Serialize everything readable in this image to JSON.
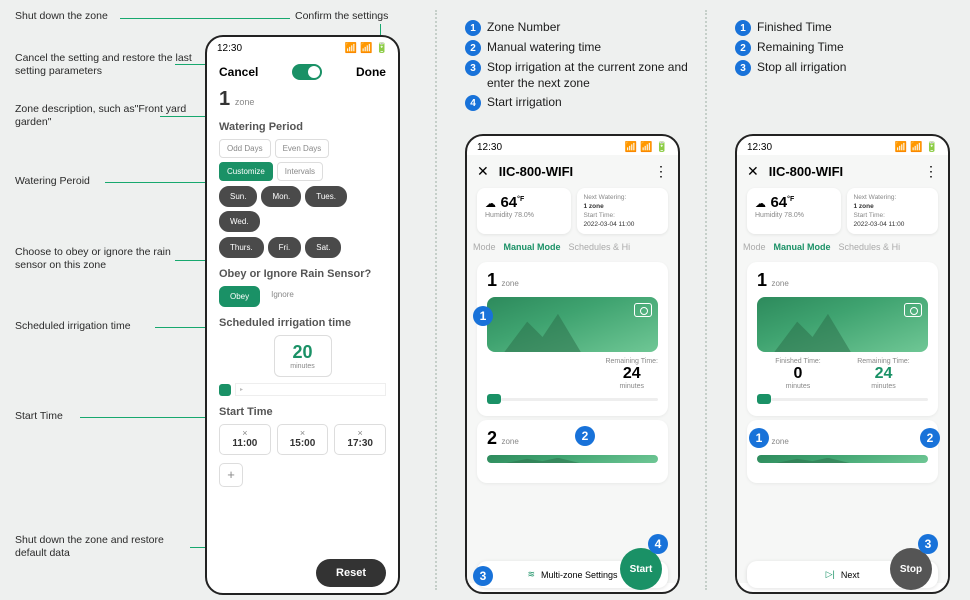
{
  "annotations": {
    "shutdown": "Shut down the zone",
    "confirm": "Confirm the settings",
    "cancel": "Cancel the setting and restore the last setting parameters",
    "zone_desc": "Zone description, such as\"Front yard garden\"",
    "watering_period": "Watering Peroid",
    "rain_sensor": "Choose to obey or ignore the rain sensor on this zone",
    "scheduled": "Scheduled irrigation time",
    "start_time": "Start Time",
    "reset": "Shut down the zone and restore default data"
  },
  "phone1": {
    "time": "12:30",
    "cancel": "Cancel",
    "done": "Done",
    "zone_num": "1",
    "zone_label": "zone",
    "watering_period_title": "Watering Period",
    "periods": [
      "Odd Days",
      "Even Days",
      "Customize",
      "Intervals"
    ],
    "days": [
      "Sun.",
      "Mon.",
      "Tues.",
      "Wed.",
      "Thurs.",
      "Fri.",
      "Sat."
    ],
    "rain_title": "Obey or Ignore Rain Sensor?",
    "obey": "Obey",
    "ignore": "Ignore",
    "sched_title": "Scheduled irrigation time",
    "sched_val": "20",
    "sched_unit": "minutes",
    "start_title": "Start Time",
    "times": [
      "11:00",
      "15:00",
      "17:30"
    ],
    "reset": "Reset"
  },
  "phone2": {
    "time": "12:30",
    "device": "IIC-800-WIFI",
    "temp": "64",
    "temp_unit": "°F",
    "humidity": "Humidity  78.0%",
    "next_label": "Next Watering:",
    "next_zone": "1 zone",
    "start_label": "Start Time:",
    "start_val": "2022-03-04 11:00",
    "tabs": [
      "Mode",
      "Manual Mode",
      "Schedules & Hi"
    ],
    "zone1_num": "1",
    "zone1_label": "zone",
    "remaining_label": "Remaining Time:",
    "remaining_val": "24",
    "remaining_unit": "minutes",
    "zone2_num": "2",
    "zone2_label": "zone",
    "multizone": "Multi-zone Settings",
    "start_btn": "Start"
  },
  "phone3": {
    "time": "12:30",
    "device": "IIC-800-WIFI",
    "temp": "64",
    "humidity": "Humidity  78.0%",
    "next_label": "Next Watering:",
    "next_zone": "1 zone",
    "start_label": "Start Time:",
    "start_val": "2022-03-04 11:00",
    "tabs": [
      "Mode",
      "Manual Mode",
      "Schedules & Hi"
    ],
    "zone1_num": "1",
    "finished_label": "Finished Time:",
    "finished_val": "0",
    "finished_unit": "minutes",
    "remaining_label": "Remaining Time:",
    "remaining_val": "24",
    "remaining_unit": "minutes",
    "zone2_num": "2",
    "next_btn": "Next",
    "stop_btn": "Stop"
  },
  "legend1": {
    "l1": "Zone Number",
    "l2": "Manual watering time",
    "l3": "Stop irrigation at the current zone and enter the next zone",
    "l4": "Start irrigation"
  },
  "legend2": {
    "l1": "Finished Time",
    "l2": "Remaining Time",
    "l3": "Stop all irrigation"
  }
}
